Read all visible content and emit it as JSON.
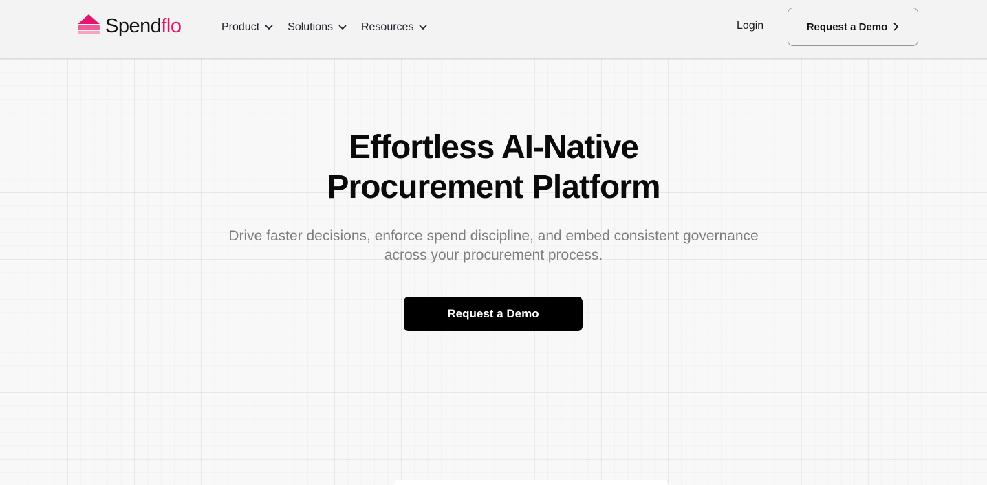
{
  "brand": {
    "name_part1": "Spend",
    "name_part2": "flo",
    "accent_color": "#e3166e"
  },
  "nav": {
    "items": [
      {
        "label": "Product",
        "icon": "chevron-down-icon"
      },
      {
        "label": "Solutions",
        "icon": "chevron-down-icon"
      },
      {
        "label": "Resources",
        "icon": "chevron-down-icon"
      }
    ],
    "login_label": "Login",
    "demo_label": "Request a Demo",
    "demo_icon": "chevron-right-icon"
  },
  "hero": {
    "title_line1": "Effortless AI-Native",
    "title_line2": "Procurement Platform",
    "subtitle_line1": "Drive faster decisions, enforce spend discipline, and embed consistent governance",
    "subtitle_line2": "across your procurement process.",
    "cta_label": "Request a Demo"
  }
}
